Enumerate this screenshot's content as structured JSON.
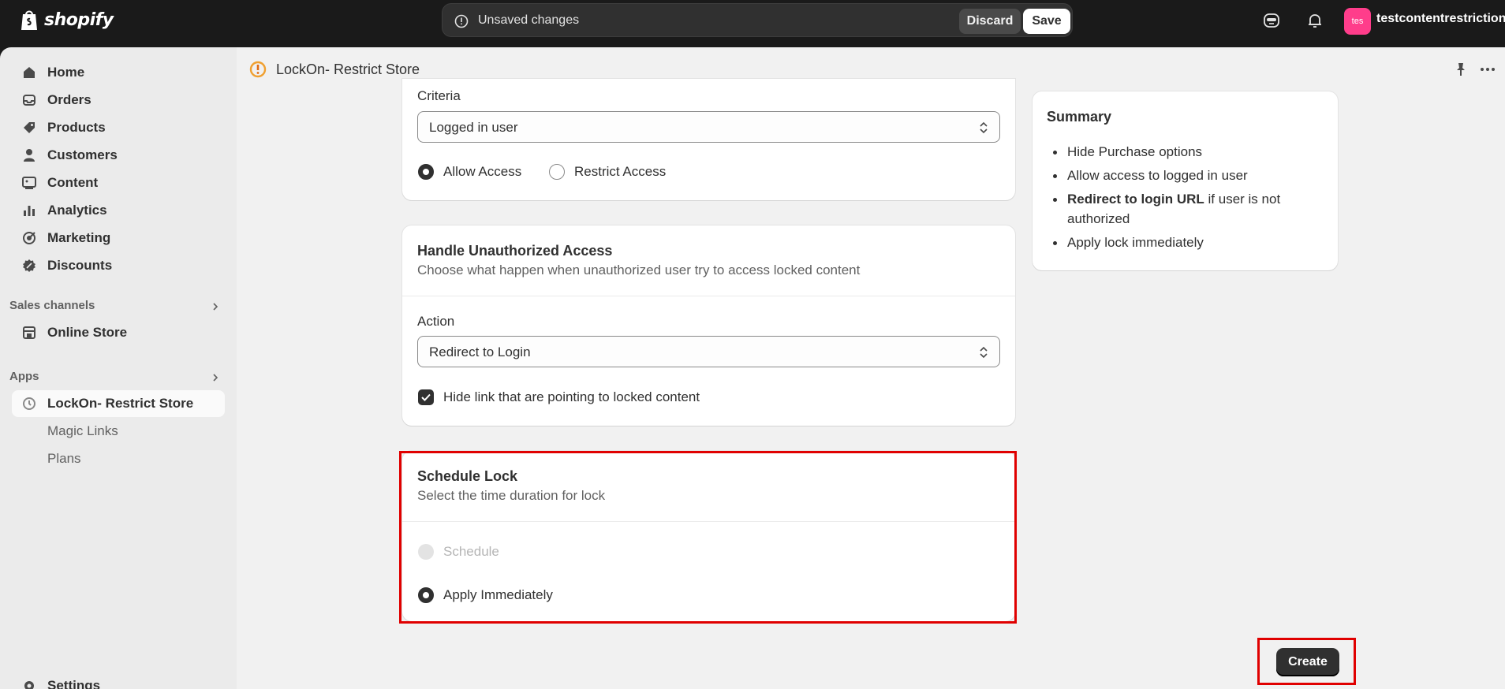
{
  "topbar": {
    "brand": "shopify",
    "unsaved_message": "Unsaved changes",
    "discard_label": "Discard",
    "save_label": "Save",
    "avatar_text": "tes",
    "store_name": "testcontentrestriction"
  },
  "sidebar": {
    "items": [
      {
        "label": "Home",
        "icon": "home-icon"
      },
      {
        "label": "Orders",
        "icon": "orders-icon"
      },
      {
        "label": "Products",
        "icon": "tag-icon"
      },
      {
        "label": "Customers",
        "icon": "person-icon"
      },
      {
        "label": "Content",
        "icon": "content-icon"
      },
      {
        "label": "Analytics",
        "icon": "bar-chart-icon"
      },
      {
        "label": "Marketing",
        "icon": "target-icon"
      },
      {
        "label": "Discounts",
        "icon": "discount-icon"
      }
    ],
    "sales_channels_header": "Sales channels",
    "online_store": "Online Store",
    "apps_header": "Apps",
    "app_name": "LockOn- Restrict Store",
    "app_subitems": [
      "Magic Links",
      "Plans"
    ],
    "settings": "Settings"
  },
  "app_header": {
    "title": "LockOn- Restrict Store"
  },
  "criteria_card": {
    "label": "Criteria",
    "select_value": "Logged in user",
    "options": [
      "Allow Access",
      "Restrict Access"
    ],
    "selected": "Allow Access"
  },
  "unauthorized_card": {
    "title": "Handle Unauthorized Access",
    "subtitle": "Choose what happen when unauthorized user try to access locked content",
    "action_label": "Action",
    "action_value": "Redirect to Login",
    "checkbox_label": "Hide link that are pointing to locked content",
    "checkbox_checked": true
  },
  "schedule_card": {
    "title": "Schedule Lock",
    "subtitle": "Select the time duration for lock",
    "options": [
      "Schedule",
      "Apply Immediately"
    ],
    "selected": "Apply Immediately"
  },
  "summary": {
    "title": "Summary",
    "items": [
      "Hide Purchase options",
      "Allow access to logged in user",
      "if user is not authorized",
      "Apply lock immediately"
    ],
    "bold_prefix": "Redirect to login URL"
  },
  "create_label": "Create",
  "colors": {
    "highlight": "#e00000",
    "avatar": "#ff3d8b",
    "primary_button": "#303030"
  }
}
